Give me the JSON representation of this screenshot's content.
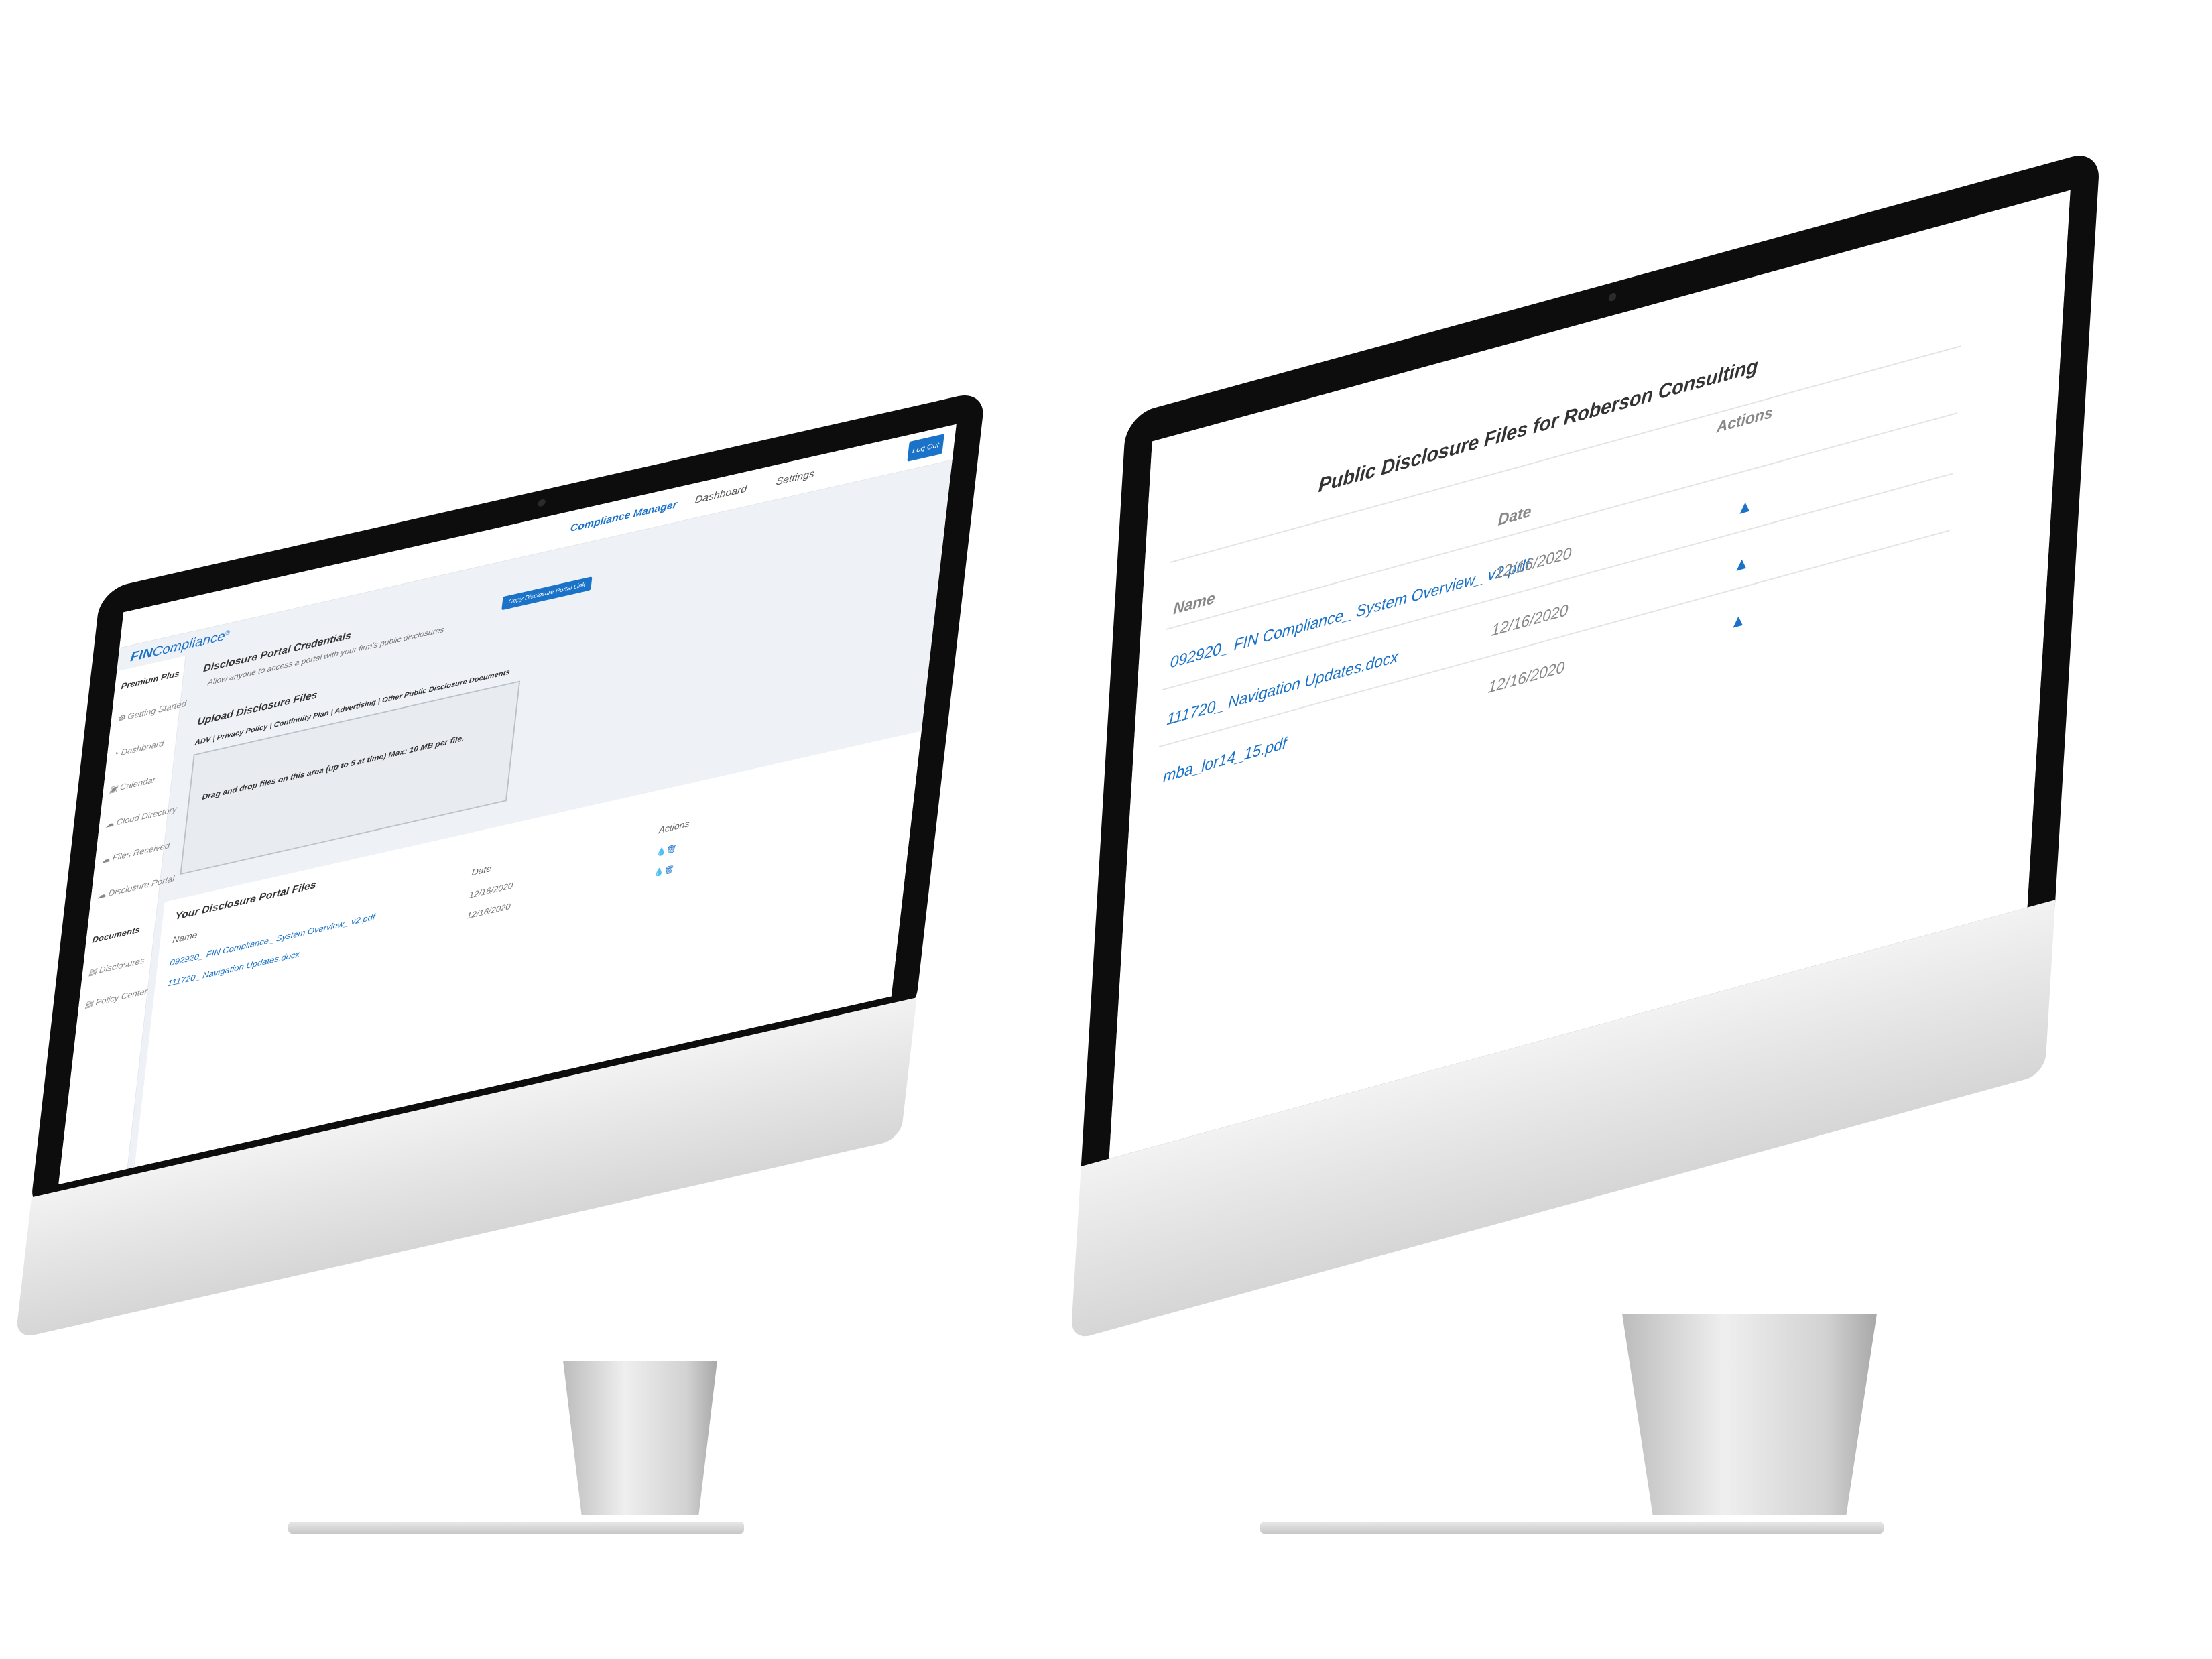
{
  "left_app": {
    "nav": {
      "compliance_manager": "Compliance Manager",
      "dashboard": "Dashboard",
      "settings": "Settings",
      "logout": "Log Out"
    },
    "brand": {
      "fin": "FIN",
      "compliance": "Compliance",
      "mark": "®"
    },
    "sidebar": {
      "plan": "Premium Plus",
      "items": [
        "Getting Started",
        "Dashboard",
        "Calendar",
        "Cloud Directory",
        "Files Received",
        "Disclosure Portal"
      ],
      "documents_header": "Documents",
      "doc_items": [
        "Disclosures",
        "Policy Center"
      ]
    },
    "credentials": {
      "title": "Disclosure Portal Credentials",
      "subtitle": "Allow anyone to access a portal with your firm's public disclosures",
      "button": "Copy Disclosure Portal Link"
    },
    "upload": {
      "title": "Upload Disclosure Files",
      "categories": "ADV | Privacy Policy | Continuity Plan | Advertising | Other Public Disclosure Documents",
      "dropzone": "Drag and drop files on this area (up to 5 at time) Max: 10 MB per file."
    },
    "files": {
      "title": "Your Disclosure Portal Files",
      "columns": {
        "name": "Name",
        "date": "Date",
        "actions": "Actions"
      },
      "rows": [
        {
          "name": "092920_ FIN Compliance_ System Overview_ v2.pdf",
          "date": "12/16/2020",
          "actions": "💧🗑"
        },
        {
          "name": "111720_ Navigation Updates.docx",
          "date": "12/16/2020",
          "actions": "💧🗑"
        }
      ]
    }
  },
  "right_app": {
    "title": "Public Disclosure Files for Roberson Consulting",
    "columns": {
      "name": "Name",
      "date": "Date",
      "actions": "Actions"
    },
    "rows": [
      {
        "name": "092920_ FIN Compliance_ System Overview_ v2.pdf",
        "date": "12/16/2020",
        "action_icon": "download-icon"
      },
      {
        "name": "111720_ Navigation Updates.docx",
        "date": "12/16/2020",
        "action_icon": "download-icon"
      },
      {
        "name": "mba_lor14_15.pdf",
        "date": "12/16/2020",
        "action_icon": "download-icon"
      }
    ]
  },
  "hardware": {
    "apple_logo": ""
  },
  "colors": {
    "accent": "#1a73c9",
    "bezel": "#0d0d0d",
    "app_bg": "#eef1f5"
  }
}
